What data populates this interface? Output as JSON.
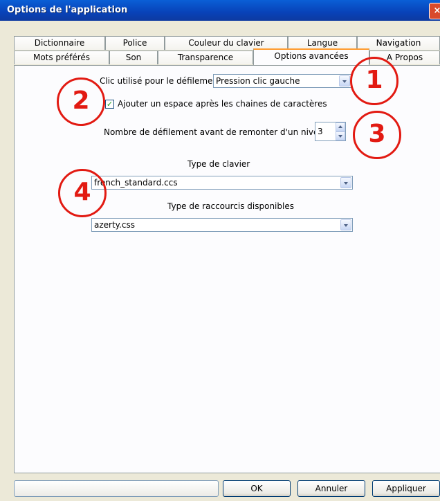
{
  "window": {
    "title": "Options de l'application",
    "close_label": "×"
  },
  "tabs_row1": [
    "Dictionnaire",
    "Police",
    "Couleur du clavier",
    "Langue",
    "Navigation"
  ],
  "tabs_row2": [
    "Mots préférés",
    "Son",
    "Transparence",
    "Options avancées",
    "A Propos"
  ],
  "active_tab": "Options avancées",
  "scroll_click": {
    "label": "Clic utilisé pour le défilement",
    "value": "Pression clic gauche"
  },
  "add_space": {
    "label": "Ajouter un espace après les chaines de caractères",
    "checked": true,
    "check_glyph": "✓"
  },
  "scroll_count": {
    "label": "Nombre de défilement avant de remonter d'un niveau",
    "value": "3"
  },
  "keyboard_type": {
    "label": "Type de clavier",
    "value": "french_standard.ccs"
  },
  "shortcut_type": {
    "label": "Type de raccourcis disponibles",
    "value": "azerty.css"
  },
  "annotations": [
    "1",
    "2",
    "3",
    "4"
  ],
  "buttons": {
    "ok": "OK",
    "cancel": "Annuler",
    "apply": "Appliquer"
  },
  "colors": {
    "annotation": "#e21a12",
    "titlebar": "#0842b8",
    "active_tab_accent": "#ff9b2d"
  }
}
